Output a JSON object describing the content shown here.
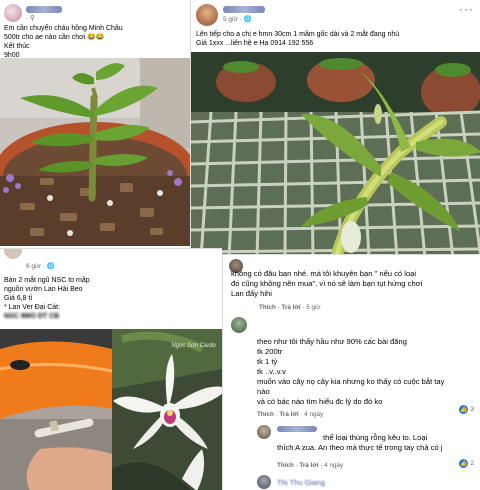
{
  "post1": {
    "author_blurred": "Ngọc Minh",
    "line1": "Em cần chuyển cháu hồng Minh Châu",
    "line2": "500tr cho ae nào cần chơi",
    "line3": "Kết thúc",
    "line4": "9h00",
    "emoji": "😂😂"
  },
  "post2": {
    "author_blurred": "Đặng Hậu",
    "time": "5 giờ · ",
    "line1": "Lên tiếp cho a chị e hmn 30cm 1 mầm gốc dài và 2 mắt đang nhú",
    "line2": "Giá 1xxx ...liên hệ e Ha 0914 192 556",
    "more": "···"
  },
  "post3": {
    "time": "6 giờ · ",
    "line1": "Bán 2 mắt ngũ NSC to mập",
    "line2": "nguồn vườn Lan Hải Beo",
    "line3": "Giá 6,8 tỉ",
    "line4": "* Lan Ver Đại Cát:",
    "blurred_line": "NSC 9MO DT CB",
    "watermark": "Ngọc Sơn Cardo"
  },
  "comments": {
    "c1_line1": "không có đâu bạn nhé. mà tôi khuyên bạn \" nếu có loại",
    "c1_line2": "đó cũng không nên mua\". vì nó sẽ làm bạn tụt hứng chơi",
    "c1_line3": "Lan đấy hihi",
    "like_label": "Thích",
    "reply_label": "Trả lời",
    "c1_time": "5 giờ",
    "c2_line1": "theo như tôi thấy hầu như 90% các bài đăng",
    "c2_line2": "tk 200tr",
    "c2_line3": "tk 1 tỷ",
    "c2_line4": "tk ..v..v.v",
    "c2_line5": "muốn vào cây nọ cây kia nhưng ko thấy có cuộc bắt tay",
    "c2_line6": "nào",
    "c2_line7": "và có bác nào tìm hiểu đc lý do đó ko",
    "c2_time": "4 ngày",
    "c2_likes": "3",
    "c3_line1": "thể loại thùng rỗng kêu to. Loại",
    "c3_line2": "thích A zua. An theo mà thực tế trong tay chả có j",
    "c3_time": "4 ngày",
    "c3_likes": "2",
    "c4_name": "Thị Thu Giang"
  },
  "colors": {
    "accent": "#1877f2",
    "meta": "#65676b",
    "bubble": "#f0f2f5"
  }
}
